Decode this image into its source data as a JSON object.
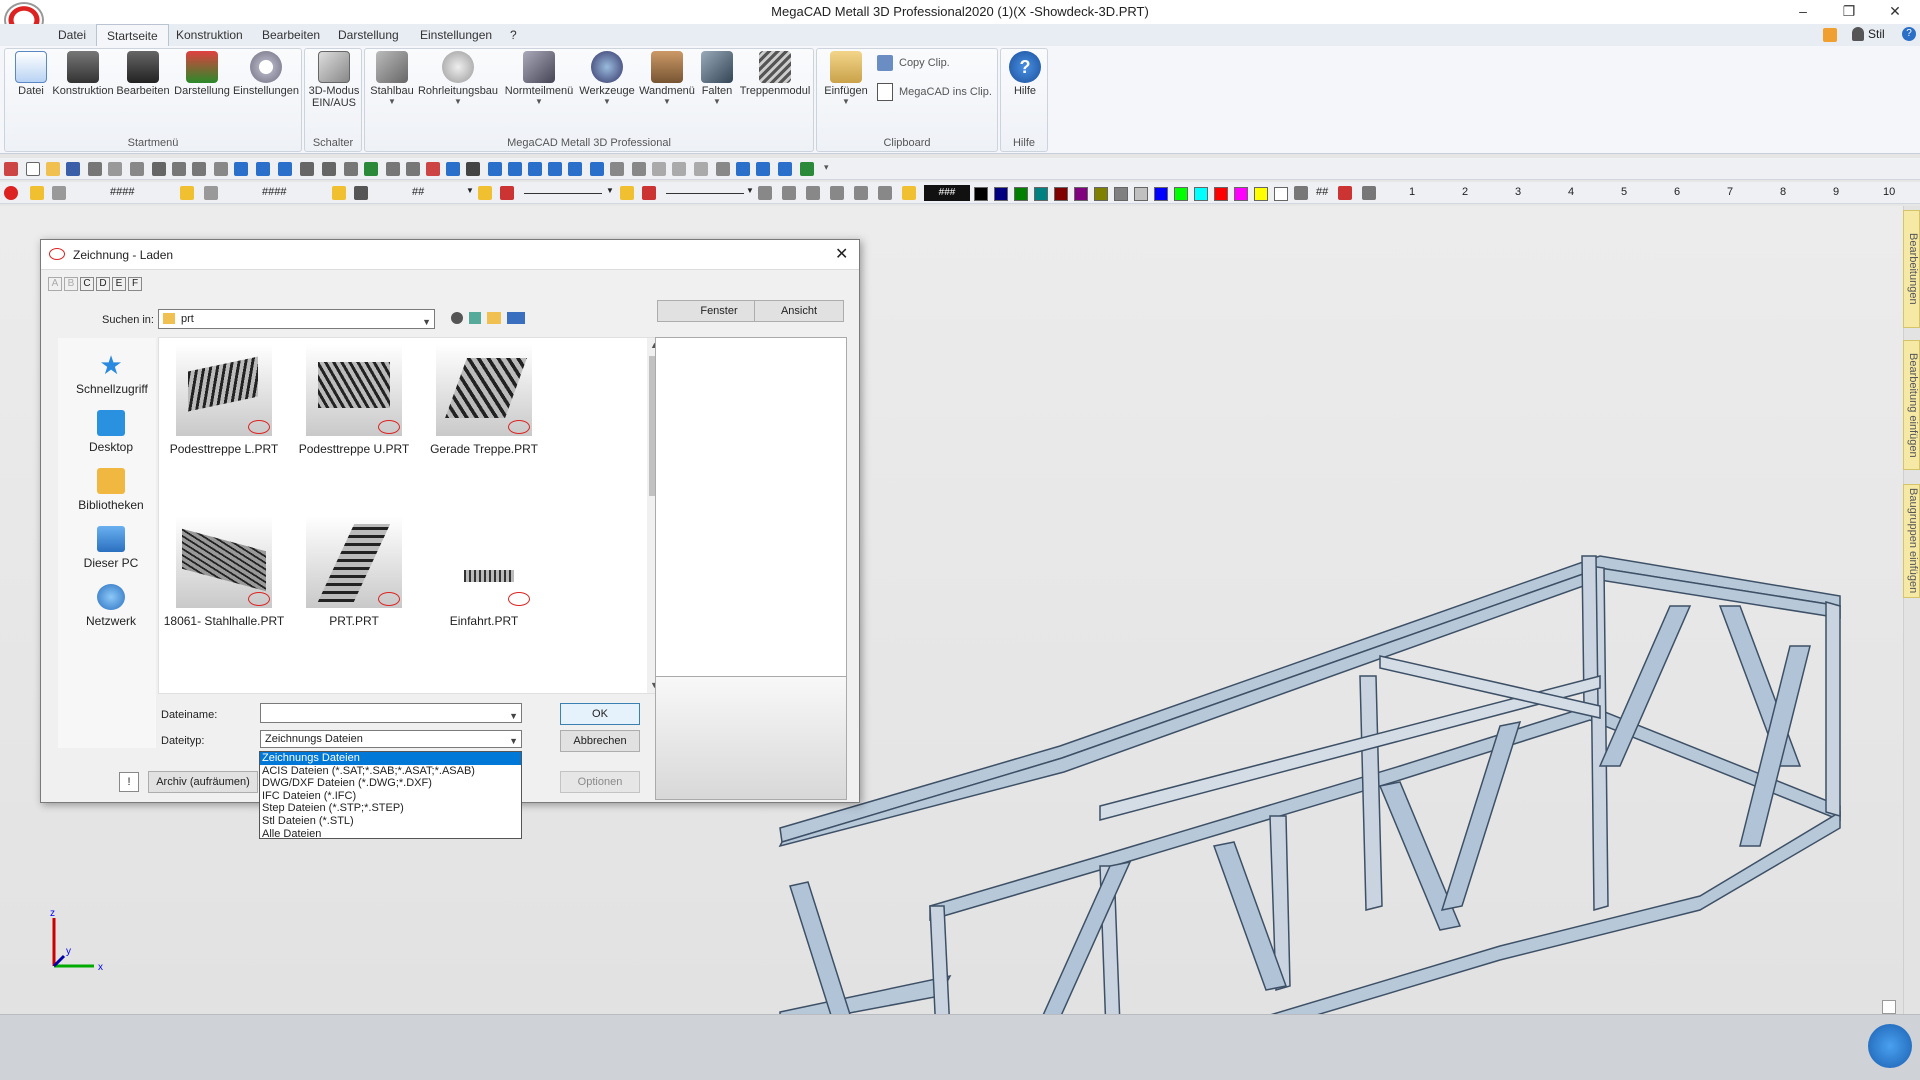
{
  "window": {
    "title": "MegaCAD Metall 3D Professional2020 (1)(X -Showdeck-3D.PRT)",
    "style_label": "Stil"
  },
  "menu": {
    "tabs": [
      "Datei",
      "Startseite",
      "Konstruktion",
      "Bearbeiten",
      "Darstellung",
      "Einstellungen",
      "?"
    ]
  },
  "ribbon": {
    "start": {
      "label": "Startmenü",
      "items": [
        "Datei",
        "Konstruktion",
        "Bearbeiten",
        "Darstellung",
        "Einstellungen"
      ]
    },
    "schalter": {
      "label": "Schalter",
      "item": "3D-Modus\nEIN/AUS"
    },
    "metall": {
      "label": "MegaCAD Metall 3D Professional",
      "items": [
        "Stahlbau",
        "Rohrleitungsbau",
        "Normteilmenü",
        "Werkzeuge",
        "Wandmenü",
        "Falten",
        "Treppenmodul"
      ]
    },
    "clipboard": {
      "label": "Clipboard",
      "paste": "Einfügen",
      "copy": "Copy Clip.",
      "copy_to": "MegaCAD ins Clip."
    },
    "help": {
      "label": "Hilfe",
      "item": "Hilfe"
    }
  },
  "toolbar2": {
    "hash1": "####",
    "hash2": "####",
    "hash3": "##",
    "hash4": "###",
    "hash5": "##",
    "ruler": [
      "1",
      "2",
      "3",
      "4",
      "5",
      "6",
      "7",
      "8",
      "9",
      "10"
    ]
  },
  "colors": [
    "#000000",
    "#000080",
    "#008000",
    "#008080",
    "#800000",
    "#800080",
    "#808000",
    "#808080",
    "#c0c0c0",
    "#0000ff",
    "#00ff00",
    "#00ffff",
    "#ff0000",
    "#ff00ff",
    "#ffff00",
    "#ffffff"
  ],
  "side_tabs": [
    "Bearbeitungen",
    "Bearbeitung einfügen",
    "Baugruppen einfügen"
  ],
  "dialog": {
    "title": "Zeichnung - Laden",
    "letters": [
      "A",
      "B",
      "C",
      "D",
      "E",
      "F"
    ],
    "lookin_label": "Suchen in:",
    "lookin_value": "prt",
    "btn_window": "Fenster",
    "btn_view": "Ansicht",
    "places": [
      "Schnellzugriff",
      "Desktop",
      "Bibliotheken",
      "Dieser PC",
      "Netzwerk"
    ],
    "files": [
      "Podesttreppe L.PRT",
      "Podesttreppe U.PRT",
      "Gerade Treppe.PRT",
      "18061- Stahlhalle.PRT",
      "PRT.PRT",
      "Einfahrt.PRT"
    ],
    "filename_label": "Dateiname:",
    "filename_value": "",
    "filetype_label": "Dateityp:",
    "filetype_value": "Zeichnungs Dateien",
    "ok": "OK",
    "cancel": "Abbrechen",
    "options": "Optionen",
    "archive": "Archiv (aufräumen)",
    "excl": "!",
    "filetype_options": [
      "Zeichnungs Dateien",
      "ACIS Dateien (*.SAT;*.SAB;*.ASAT;*.ASAB)",
      "DWG/DXF Dateien (*.DWG;*.DXF)",
      "IFC Dateien (*.IFC)",
      "Step Dateien (*.STP;*.STEP)",
      "Stl Dateien (*.STL)",
      "Alle Dateien"
    ]
  },
  "axes": {
    "x": "x",
    "y": "y",
    "z": "z"
  }
}
